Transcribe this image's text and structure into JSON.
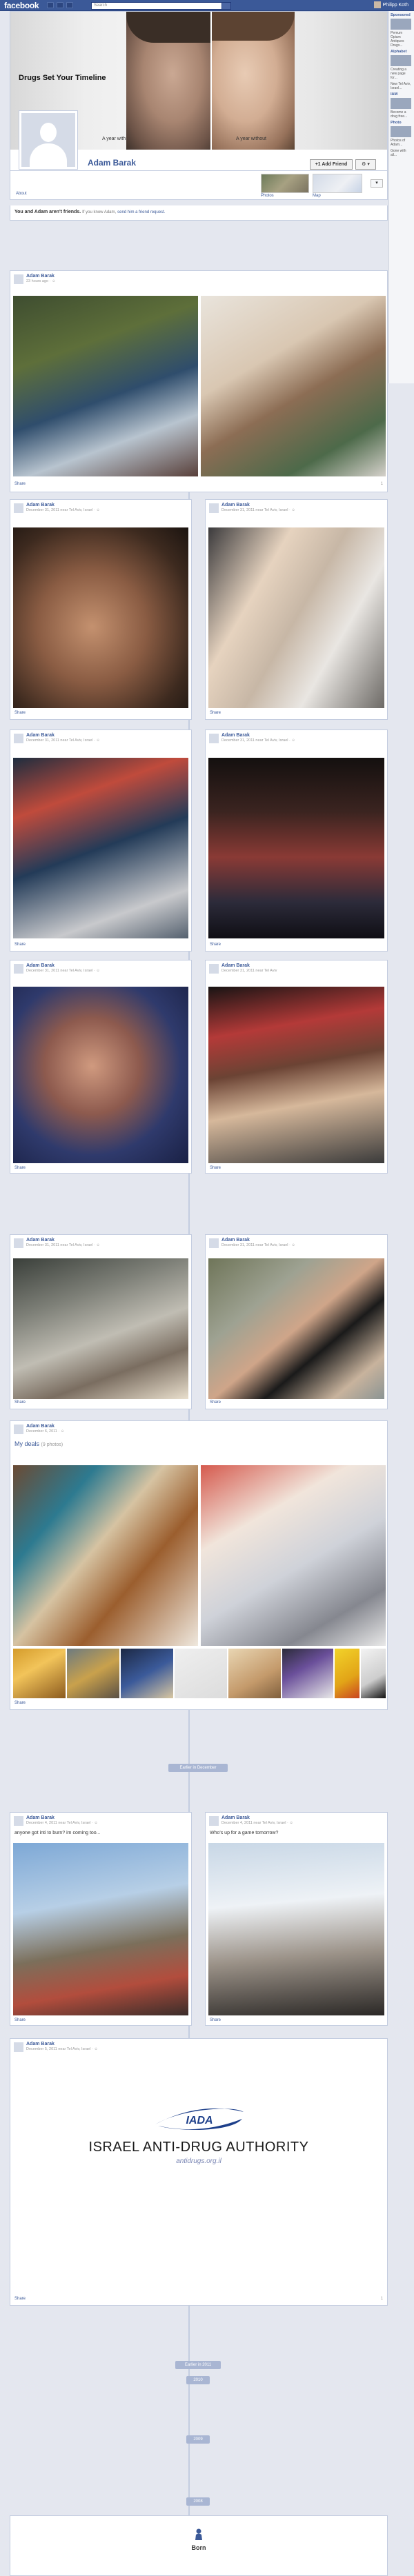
{
  "topbar": {
    "logo": "facebook",
    "search_placeholder": "Search",
    "user_name": "Philipp Koth"
  },
  "cover": {
    "title": "Drugs Set Your Timeline",
    "caption_with": "A year with",
    "caption_without": "A year without"
  },
  "profile": {
    "name": "Adam Barak",
    "add_friend_label": "+1 Add Friend",
    "gear_label": "⚙ ▾",
    "nav_about": "About",
    "nav_photos": "Photos",
    "nav_map": "Map",
    "nav_more": "▾"
  },
  "friendship": {
    "text": "You and Adam aren't friends.",
    "sub": "If you know Adam,",
    "link": "send him a friend request."
  },
  "rightcol": {
    "blocks": [
      {
        "title": "Sponsored",
        "text": "Pemum Opium Antiques Drugs..."
      },
      {
        "title": "Alphabet",
        "text": "Creating a new page for..."
      },
      {
        "title": "",
        "text": "New Tel Aviv, Israel..."
      },
      {
        "title": "IAM",
        "text": "Become a drug free..."
      },
      {
        "title": "Photo",
        "text": "Photos of Adam..."
      },
      {
        "title": "",
        "text": "Gone with all..."
      }
    ]
  },
  "posts": {
    "author": "Adam Barak",
    "p1_meta": "23 hours ago · ☺",
    "p_meta": "December 31, 2011 near Tel Aviv, Israel · ☺",
    "p_dinner_meta": "December 31, 2011 near Tel Aviv",
    "album_meta": "December 6, 2011 · ☺",
    "album_title": "My deals",
    "album_count": "(9 photos)",
    "p_anyone_meta": "December 4, 2011 near Tel Aviv, Israel · ☺",
    "p_anyone_text": "anyone got inti to burn? im coming too...",
    "p_whos_text": "Who's up for a game tomorrow?",
    "iada_meta": "December 5, 2011 near Tel Aviv, Israel · ☺",
    "share": "Share",
    "count_1": "1",
    "count_2": "1"
  },
  "iada": {
    "abbr": "IADA",
    "name": "ISRAEL ANTI-DRUG AUTHORITY",
    "url": "antidrugs.org.il"
  },
  "years": {
    "earlier_2011": "Earlier in December",
    "y2011": "Earlier in 2011",
    "y2010": "2010",
    "y2009": "2009",
    "y2008": "2008",
    "born": "Born"
  },
  "colors": {
    "facebook_blue": "#3b5998",
    "background": "#e4e7ef"
  }
}
